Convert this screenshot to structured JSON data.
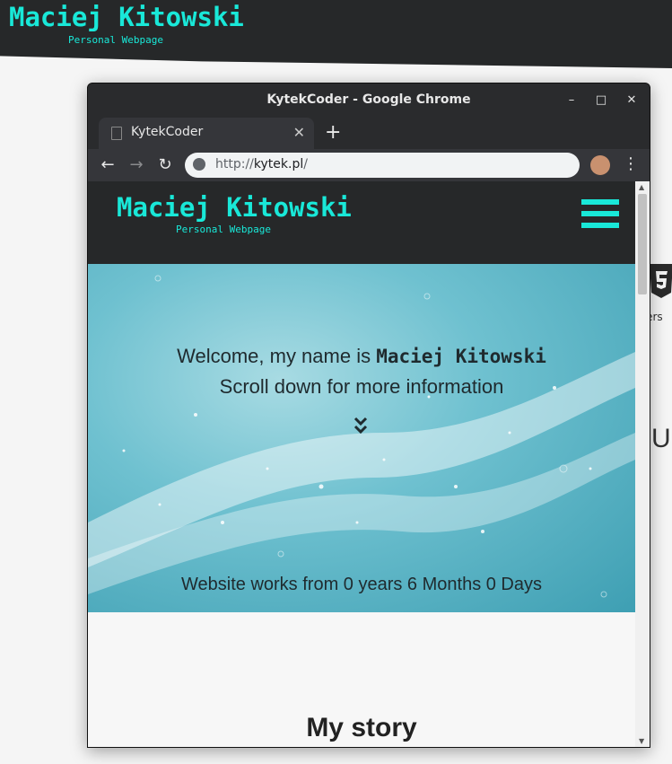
{
  "background_page": {
    "title": "Maciej Kitowski",
    "subtitle": "Personal Webpage",
    "partial_text_vers": "vers",
    "partial_text_u": "U"
  },
  "window": {
    "title": "KytekCoder - Google Chrome",
    "controls": [
      "–",
      "□",
      "✕"
    ]
  },
  "tab": {
    "label": "KytekCoder",
    "close": "✕",
    "new_tab": "+"
  },
  "address_bar": {
    "scheme": "http://",
    "host": "kytek.pl",
    "path": "/"
  },
  "site": {
    "title": "Maciej Kitowski",
    "subtitle": "Personal Webpage",
    "hero": {
      "welcome_prefix": "Welcome, my name is ",
      "welcome_name": "Maciej Kitowski",
      "scroll_text": "Scroll down for more information",
      "uptime_text": "Website works from 0 years 6 Months 0 Days"
    },
    "section_title": "My story"
  },
  "colors": {
    "accent": "#19e8d8",
    "header_bg": "#262829",
    "chrome_dark": "#2a2b2d"
  }
}
